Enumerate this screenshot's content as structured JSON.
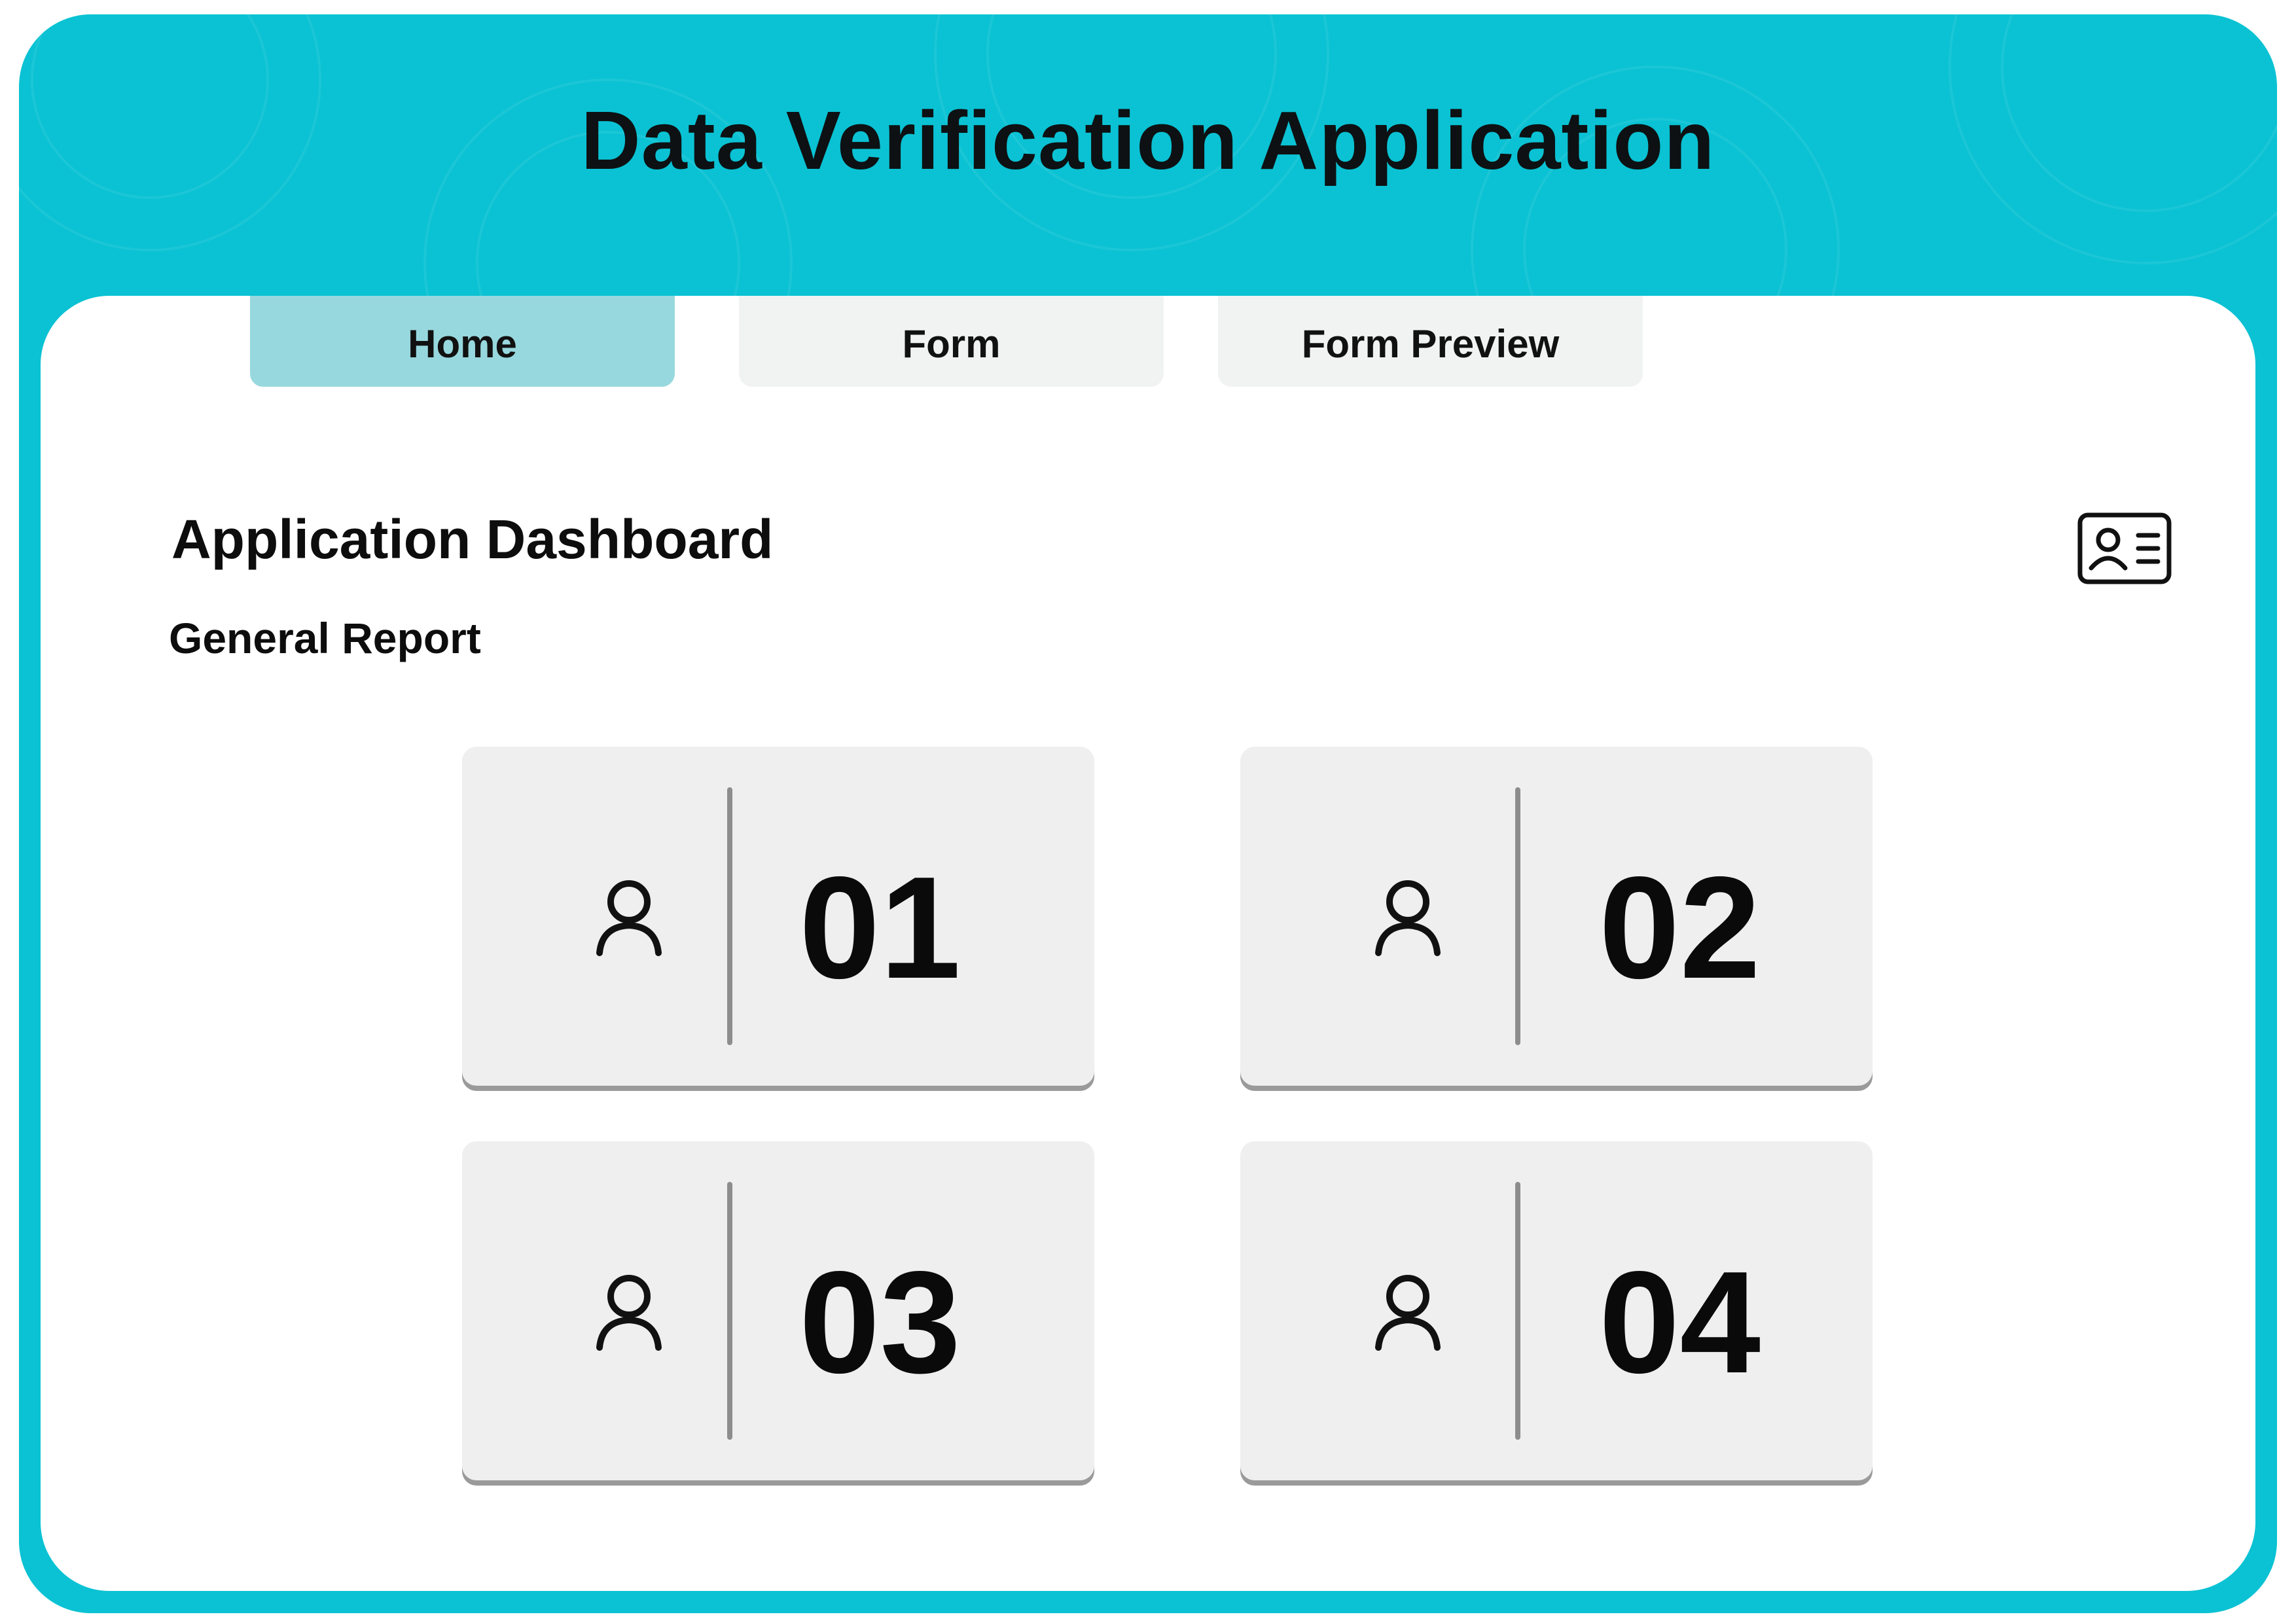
{
  "header": {
    "title": "Data Verification Application"
  },
  "tabs": [
    {
      "label": "Home",
      "active": true
    },
    {
      "label": "Form",
      "active": false
    },
    {
      "label": "Form Preview",
      "active": false
    }
  ],
  "dashboard": {
    "title": "Application Dashboard",
    "subtitle": "General Report",
    "profile_icon": "id-card-icon"
  },
  "cards": [
    {
      "number": "01",
      "icon": "user-icon"
    },
    {
      "number": "02",
      "icon": "user-icon"
    },
    {
      "number": "03",
      "icon": "user-icon"
    },
    {
      "number": "04",
      "icon": "user-icon"
    }
  ],
  "colors": {
    "frame": "#0ac2d3",
    "active_tab": "#97d8de",
    "inactive_tab": "#f1f3f3",
    "card": "#efefef",
    "text": "#0d0d0d"
  }
}
